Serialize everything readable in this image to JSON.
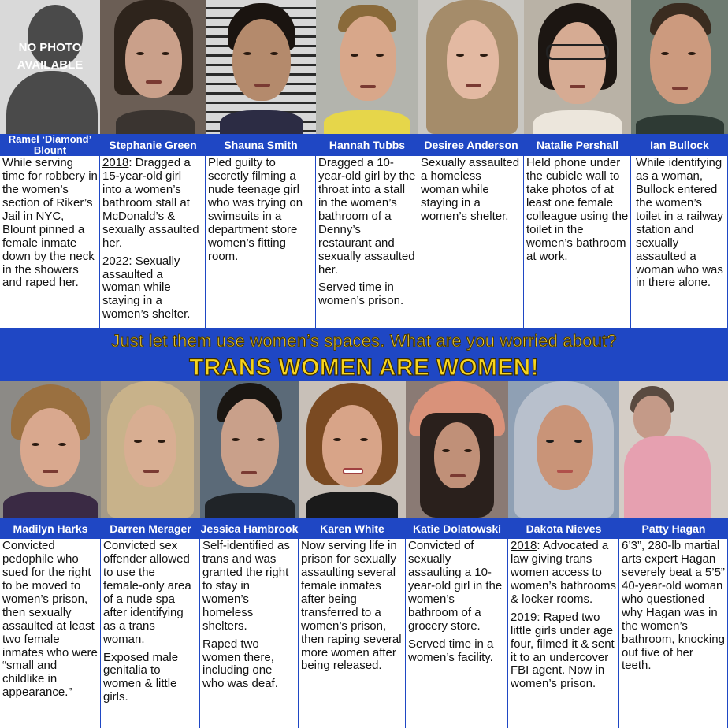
{
  "top": [
    {
      "name": "Ramel ‘Diamond’ Blount",
      "no_photo": "NO PHOTO AVAILABLE",
      "bio": [
        "While serving time for robbery in the women’s section of Riker’s Jail in NYC, Blount pinned a female inmate down by the neck in the showers and raped her."
      ]
    },
    {
      "name": "Stephanie Green",
      "bio_a_year": "2018",
      "bio_a": ": Dragged a 15-year-old girl into a women’s bathroom stall at McDonald’s & sexually assaulted her.",
      "bio_b_year": "2022",
      "bio_b": ": Sexually assaulted a woman while staying in a women’s shelter."
    },
    {
      "name": "Shauna Smith",
      "bio": [
        "Pled guilty to secretly filming a nude teenage girl who was trying on swimsuits in a department store women’s fitting room."
      ]
    },
    {
      "name": "Hannah Tubbs",
      "bio": [
        "Dragged a 10-year-old girl by the throat into a stall in the women’s bathroom of a Denny’s restaurant and sexually assaulted her.",
        "Served time in women’s prison."
      ]
    },
    {
      "name": "Desiree Anderson",
      "bio": [
        "Sexually assaulted a homeless woman while staying in a women’s shelter."
      ]
    },
    {
      "name": "Natalie Pershall",
      "bio": [
        "Held phone under the cubicle wall to take photos of at least one female colleague using the toilet in the women’s bathroom at work."
      ]
    },
    {
      "name": "Ian Bullock",
      "bio": [
        "While identifying as a woman, Bullock entered the women’s toilet in a railway station and sexually assaulted a woman who was in there alone."
      ]
    }
  ],
  "banner": {
    "line1": "Just let them use women’s spaces. What are you worried about?",
    "line2": "TRANS WOMEN ARE WOMEN!"
  },
  "bottom": [
    {
      "name": "Madilyn Harks",
      "bio": [
        "Convicted pedophile who sued for the right to be moved to women’s prison, then sexually assaulted at least two female inmates who were “small and childlike in appearance.”"
      ]
    },
    {
      "name": "Darren Merager",
      "bio": [
        "Convicted sex offender allowed to use the female-only area of a nude spa after identifying as a trans woman.",
        "Exposed male genitalia to women & little girls."
      ]
    },
    {
      "name": "Jessica Hambrook",
      "bio": [
        "Self-identified as trans and was granted the right to stay in women’s homeless shelters.",
        "Raped two women there, including one who was deaf."
      ]
    },
    {
      "name": "Karen White",
      "bio": [
        "Now serving life in prison for sexually assaulting several female inmates after being transferred to a women’s prison, then raping several more women after being released."
      ]
    },
    {
      "name": "Katie Dolatowski",
      "bio": [
        "Convicted of sexually assaulting a 10-year-old girl in the women’s bathroom of a grocery store.",
        "Served time in a women’s facility."
      ]
    },
    {
      "name": "Dakota Nieves",
      "bio_a_year": "2018",
      "bio_a": ": Advocated a law giving trans women access to women’s bathrooms & locker rooms.",
      "bio_b_year": "2019",
      "bio_b": ": Raped two little girls under age four, filmed it & sent it to an undercover FBI agent. Now in women’s prison."
    },
    {
      "name": "Patty Hagan",
      "bio": [
        "6’3”, 280-lb martial arts expert Hagan severely beat a 5’5” 40-year-old woman who questioned why Hagan was in the women’s bathroom, knocking out five of her teeth."
      ]
    }
  ],
  "colors": {
    "background": "#1f47c4",
    "banner_text": "#f7d51f",
    "bio_bg": "#ffffff"
  }
}
